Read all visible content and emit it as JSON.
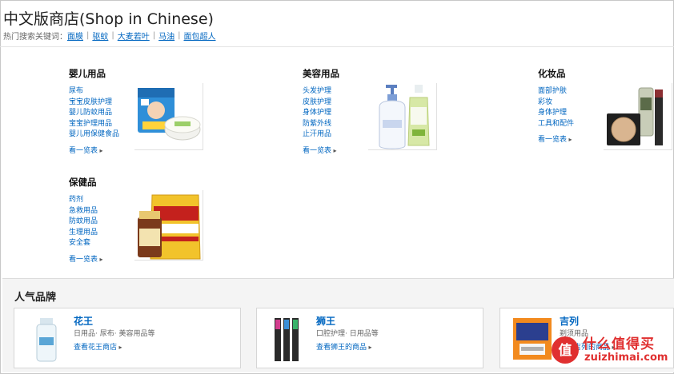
{
  "page": {
    "title": "中文版商店(Shop in Chinese)"
  },
  "hot_search": {
    "label": "热门搜索关键词：",
    "links": [
      "面膜",
      "驱蚊",
      "大麦若叶",
      "马油",
      "面包超人"
    ]
  },
  "categories": [
    {
      "title": "婴儿用品",
      "items": [
        "尿布",
        "宝宝皮肤护理",
        "婴儿防蚊用品",
        "宝宝护理用品",
        "婴儿用保健食品"
      ],
      "more": "看一览表"
    },
    {
      "title": "美容用品",
      "items": [
        "头发护理",
        "皮肤护理",
        "身体护理",
        "防紫外线",
        "止汗用品"
      ],
      "more": "看一览表"
    },
    {
      "title": "化妆品",
      "items": [
        "面部护肤",
        "彩妆",
        "身体护理",
        "工具和配件"
      ],
      "more": "看一览表"
    },
    {
      "title": "保健品",
      "items": [
        "药剂",
        "急救用品",
        "防蚊用品",
        "生理用品",
        "安全套"
      ],
      "more": "看一览表"
    }
  ],
  "brands": {
    "title": "人气品牌",
    "cards": [
      {
        "name": "花王",
        "desc": "日用品· 尿布· 美容用品等",
        "link": "查看花王商店"
      },
      {
        "name": "狮王",
        "desc": "口腔护理· 日用品等",
        "link": "查看狮王的商品"
      },
      {
        "name": "吉列",
        "desc": "剃须用品",
        "link": "查看吉列的商品"
      }
    ]
  },
  "watermark": {
    "text": "什么值得买",
    "url": "zuizhimai.com",
    "badge": "值"
  },
  "colors": {
    "link": "#0066c0",
    "watermark": "#e03030"
  }
}
